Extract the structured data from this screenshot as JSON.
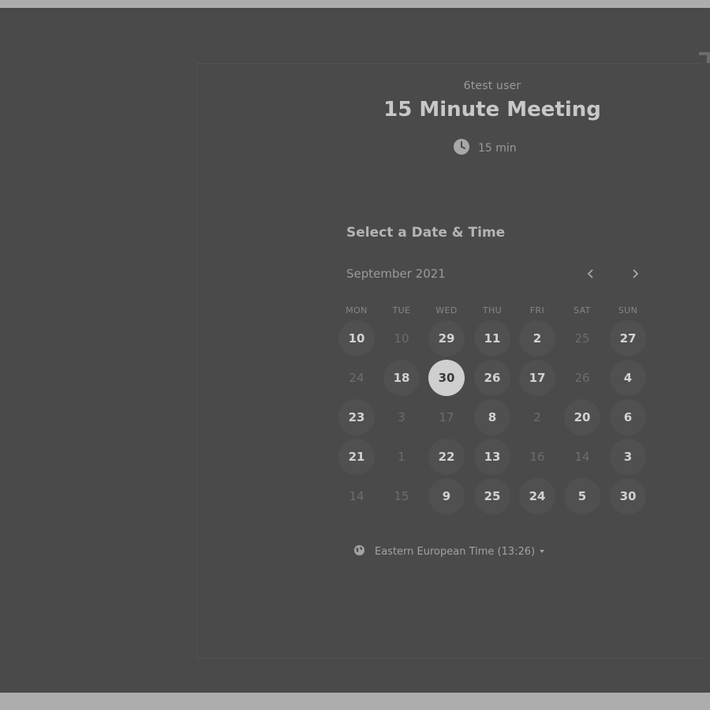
{
  "header": {
    "host_name": "6test user",
    "event_title": "15 Minute Meeting",
    "duration": "15 min",
    "duration_icon": "clock-icon"
  },
  "scheduler": {
    "section_title": "Select a Date & Time",
    "month_label": "September 2021",
    "prev_icon": "chevron-left-icon",
    "next_icon": "chevron-right-icon",
    "weekdays": [
      "MON",
      "TUE",
      "WED",
      "THU",
      "FRI",
      "SAT",
      "SUN"
    ],
    "weeks": [
      [
        {
          "label": "10",
          "available": true
        },
        {
          "label": "10",
          "available": false
        },
        {
          "label": "29",
          "available": true
        },
        {
          "label": "11",
          "available": true
        },
        {
          "label": "2",
          "available": true
        },
        {
          "label": "25",
          "available": false
        },
        {
          "label": "27",
          "available": true
        }
      ],
      [
        {
          "label": "24",
          "available": false
        },
        {
          "label": "18",
          "available": true
        },
        {
          "label": "30",
          "available": true,
          "selected": true
        },
        {
          "label": "26",
          "available": true
        },
        {
          "label": "17",
          "available": true
        },
        {
          "label": "26",
          "available": false
        },
        {
          "label": "4",
          "available": true
        }
      ],
      [
        {
          "label": "23",
          "available": true
        },
        {
          "label": "3",
          "available": false
        },
        {
          "label": "17",
          "available": false
        },
        {
          "label": "8",
          "available": true
        },
        {
          "label": "2",
          "available": false
        },
        {
          "label": "20",
          "available": true
        },
        {
          "label": "6",
          "available": true
        }
      ],
      [
        {
          "label": "21",
          "available": true
        },
        {
          "label": "1",
          "available": false
        },
        {
          "label": "22",
          "available": true
        },
        {
          "label": "13",
          "available": true
        },
        {
          "label": "16",
          "available": false
        },
        {
          "label": "14",
          "available": false
        },
        {
          "label": "3",
          "available": true
        }
      ],
      [
        {
          "label": "14",
          "available": false
        },
        {
          "label": "15",
          "available": false
        },
        {
          "label": "9",
          "available": true
        },
        {
          "label": "25",
          "available": true
        },
        {
          "label": "24",
          "available": true
        },
        {
          "label": "5",
          "available": true
        },
        {
          "label": "30",
          "available": true
        }
      ]
    ],
    "timezone_label": "Eastern European Time (13:26)",
    "timezone_icon": "globe-icon"
  },
  "colors": {
    "overlay_background": "#4a4a4a",
    "available_day_bg": "#505050",
    "selected_day_bg": "#cfcfcf"
  }
}
